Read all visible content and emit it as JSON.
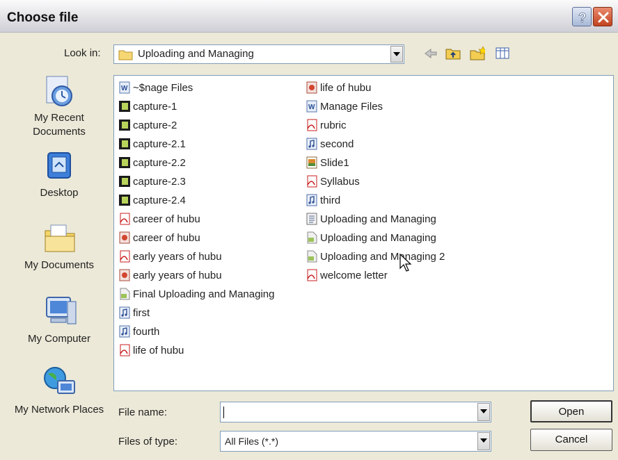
{
  "window": {
    "title": "Choose file"
  },
  "lookin": {
    "label": "Look in:",
    "value": "Uploading and Managing"
  },
  "places": [
    {
      "label": "My Recent Documents",
      "icon": "recent-documents-icon"
    },
    {
      "label": "Desktop",
      "icon": "desktop-icon"
    },
    {
      "label": "My Documents",
      "icon": "my-documents-icon"
    },
    {
      "label": "My Computer",
      "icon": "my-computer-icon"
    },
    {
      "label": "My Network Places",
      "icon": "network-places-icon"
    }
  ],
  "files": [
    {
      "name": "~$nage Files",
      "type": "word"
    },
    {
      "name": "capture-1",
      "type": "video"
    },
    {
      "name": "capture-2",
      "type": "video"
    },
    {
      "name": "capture-2.1",
      "type": "video"
    },
    {
      "name": "capture-2.2",
      "type": "video"
    },
    {
      "name": "capture-2.3",
      "type": "video"
    },
    {
      "name": "capture-2.4",
      "type": "video"
    },
    {
      "name": "career of hubu",
      "type": "pdf"
    },
    {
      "name": "career of hubu",
      "type": "ppt"
    },
    {
      "name": "early years of hubu",
      "type": "pdf"
    },
    {
      "name": "early years of hubu",
      "type": "ppt"
    },
    {
      "name": "Final Uploading and Managing",
      "type": "generic"
    },
    {
      "name": "first",
      "type": "audio"
    },
    {
      "name": "fourth",
      "type": "audio"
    },
    {
      "name": "life of hubu",
      "type": "pdf"
    },
    {
      "name": "life of hubu",
      "type": "ppt"
    },
    {
      "name": "Manage Files",
      "type": "word"
    },
    {
      "name": "rubric",
      "type": "pdf"
    },
    {
      "name": "second",
      "type": "audio"
    },
    {
      "name": "Slide1",
      "type": "image"
    },
    {
      "name": "Syllabus",
      "type": "pdf"
    },
    {
      "name": "third",
      "type": "audio"
    },
    {
      "name": "Uploading and Managing",
      "type": "doc"
    },
    {
      "name": "Uploading and Managing",
      "type": "generic"
    },
    {
      "name": "Uploading and Managing 2",
      "type": "generic"
    },
    {
      "name": "welcome letter",
      "type": "pdf"
    }
  ],
  "filename": {
    "label": "File name:",
    "value": ""
  },
  "filetype": {
    "label": "Files of type:",
    "value": "All Files (*.*)"
  },
  "buttons": {
    "open": "Open",
    "cancel": "Cancel"
  }
}
